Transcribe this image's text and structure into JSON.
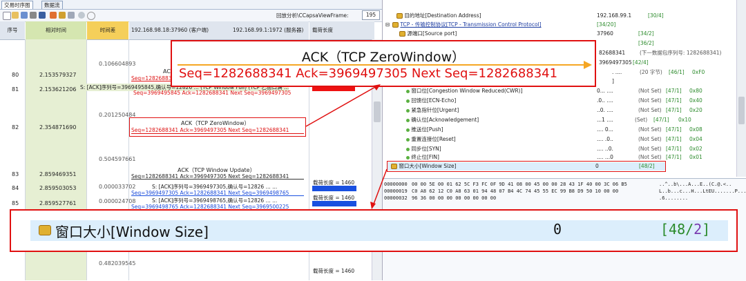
{
  "tabs": [
    "交易时序图",
    "数据流"
  ],
  "toolbar": {
    "analysis_label": "回放分析\\CCapsaViewFrame:",
    "frame_value": "195",
    "icons": [
      "pointer-icon",
      "packet-icon",
      "list-icon",
      "film-icon",
      "table-icon",
      "export-icon",
      "settings-icon",
      "filter-icon",
      "record-icon",
      "circle-icon"
    ]
  },
  "columns": {
    "no": "序号",
    "rel_time": "相对时间",
    "delta": "时间差",
    "client": "192.168.98.18:37960 (客户端)",
    "server": "192.168.99.1:1972 (服务器)",
    "len": "载荷长度"
  },
  "rows": {
    "r80": {
      "no": "80",
      "rel": "2.153579327"
    },
    "r81": {
      "no": "81",
      "rel": "2.153621206"
    },
    "r82": {
      "no": "82",
      "rel": "2.354871690"
    },
    "r83": {
      "no": "83",
      "rel": "2.859469351"
    },
    "r84": {
      "no": "84",
      "rel": "2.859503053"
    },
    "r85": {
      "no": "85",
      "rel": "2.859527761"
    }
  },
  "deltas": {
    "d1": "0.106604893",
    "d2": "0.201250484",
    "d3": "0.504597661",
    "d4": "0.000033702",
    "d5": "0.000024708",
    "d6": "0.482039545"
  },
  "flows": {
    "f80_title": "ACK",
    "f80_seq": "Seq=12826883",
    "f81_text": "S: [ACK]序列号=3969495845,确认号=12826 ... (TCP Window Full) (TCP 乙窗口满 ...",
    "f81_seq": "Seq=3969495845 Ack=1282688341 Next Seq=3969497305",
    "f82_title": "ACK（TCP ZeroWindow）",
    "f82_seq": "Seq=1282688341  Ack=3969497305  Next Seq=1282688341",
    "f83_title": "ACK（TCP Window Update）",
    "f83_seq": "Seq=1282688341  Ack=3969497305  Next Seq=1282688341",
    "f84_text": "S: [ACK]序列号=3969497305,确认号=12826 ... ...",
    "f84_seq": "Seq=3969497305  Ack=1282688341  Next Seq=3969498765",
    "f85_text": "S: [ACK]序列号=3969498765,确认号=12826 ... ...",
    "f85_seq": "Seq=3969498765  Ack=1282688341  Next Seq=3969500225"
  },
  "lens": {
    "l83": "载荷长度 = 1460",
    "l84": "载荷长度 = 1460",
    "l_bottom": "载荷长度 = 1460"
  },
  "tree": {
    "dest_addr": {
      "label": "目的地址[Destination Address]",
      "value": "192.168.99.1",
      "pos": "[30/4]"
    },
    "tcp": {
      "label": "TCP - 传输控制协议[TCP - Transmission Control Protocol]",
      "pos": "[34/20]"
    },
    "src_port": {
      "label": "源端口[Source port]",
      "value": "37960",
      "pos": "[34/2]"
    },
    "blank_pos": "[36/2]",
    "seq_val": "82688341",
    "seq_note": "(下一数据包序列号: 1282688341)",
    "ack_val": "3969497305",
    "ack_pos": "[42/4]",
    "hdrlen_dots": ". ....",
    "hdrlen_note": "(20 字节)",
    "hdrlen_pos": "[46/1]",
    "hdrlen_hex": "0xF0",
    "flags_pos": "]",
    "flag_cwr": {
      "label": "窗口位[Congestion Window Reduced(CWR)]",
      "dots": "0... ....",
      "state": "(Not Set)",
      "pos": "[47/1]",
      "hex": "0x80"
    },
    "flag_ece": {
      "label": "回馈位[ECN-Echo]",
      "dots": ".0.. ....",
      "state": "(Not Set)",
      "pos": "[47/1]",
      "hex": "0x40"
    },
    "flag_urg": {
      "label": "紧急指针位[Urgent]",
      "dots": "..0. ....",
      "state": "(Not Set)",
      "pos": "[47/1]",
      "hex": "0x20"
    },
    "flag_ack": {
      "label": "确认位[Acknowledgement]",
      "dots": "...1 ....",
      "state": "(Set)",
      "pos": "[47/1]",
      "hex": "0x10"
    },
    "flag_psh": {
      "label": "推送位[Push]",
      "dots": ".... 0...",
      "state": "(Not Set)",
      "pos": "[47/1]",
      "hex": "0x08"
    },
    "flag_rst": {
      "label": "重置连接位[Reset]",
      "dots": ".... .0..",
      "state": "(Not Set)",
      "pos": "[47/1]",
      "hex": "0x04"
    },
    "flag_syn": {
      "label": "同步位[SYN]",
      "dots": ".... ..0.",
      "state": "(Not Set)",
      "pos": "[47/1]",
      "hex": "0x02"
    },
    "flag_fin": {
      "label": "终止位[FIN]",
      "dots": ".... ...0",
      "state": "(Not Set)",
      "pos": "[47/1]",
      "hex": "0x01"
    },
    "window": {
      "label": "窗口大小[Window Size]",
      "value": "0",
      "pos": "[48/2]"
    }
  },
  "hex": {
    "rows": [
      {
        "off": "00000000",
        "bytes": "00 00 5E 00 01 62 5C F3 FC 0F 9D 41 08 00 45 00 00 28 43 1F 40 00 3C 06 B5",
        "ascii": "..^..b\\...A...E..(C.@.<.."
      },
      {
        "off": "00000019",
        "bytes": "C0 A8 62 12 C0 A8 63 01 94 48 07 B4 4C 74 45 55 EC 99 B8 D9 50 10 00 00",
        "ascii": "L..b...c...H...LtEU.......P..."
      },
      {
        "off": "00000032",
        "bytes": "96 36 00 00 00 00 00 00 00 00",
        "ascii": ".6........"
      }
    ]
  },
  "callout_top": {
    "title": "ACK（TCP ZeroWindow）",
    "seq": "Seq=1282688341  Ack=3969497305  Next Seq=1282688341"
  },
  "callout_bottom": {
    "label": "窗口大小[Window Size]",
    "value": "0",
    "pos_open": "[48/",
    "pos_num": "2",
    "pos_close": "]"
  },
  "colors": {
    "red": "#e01010",
    "blue": "#1950e0",
    "orange": "#f5a623",
    "green": "#d5e6b0",
    "yellow": "#f5cf5a"
  }
}
